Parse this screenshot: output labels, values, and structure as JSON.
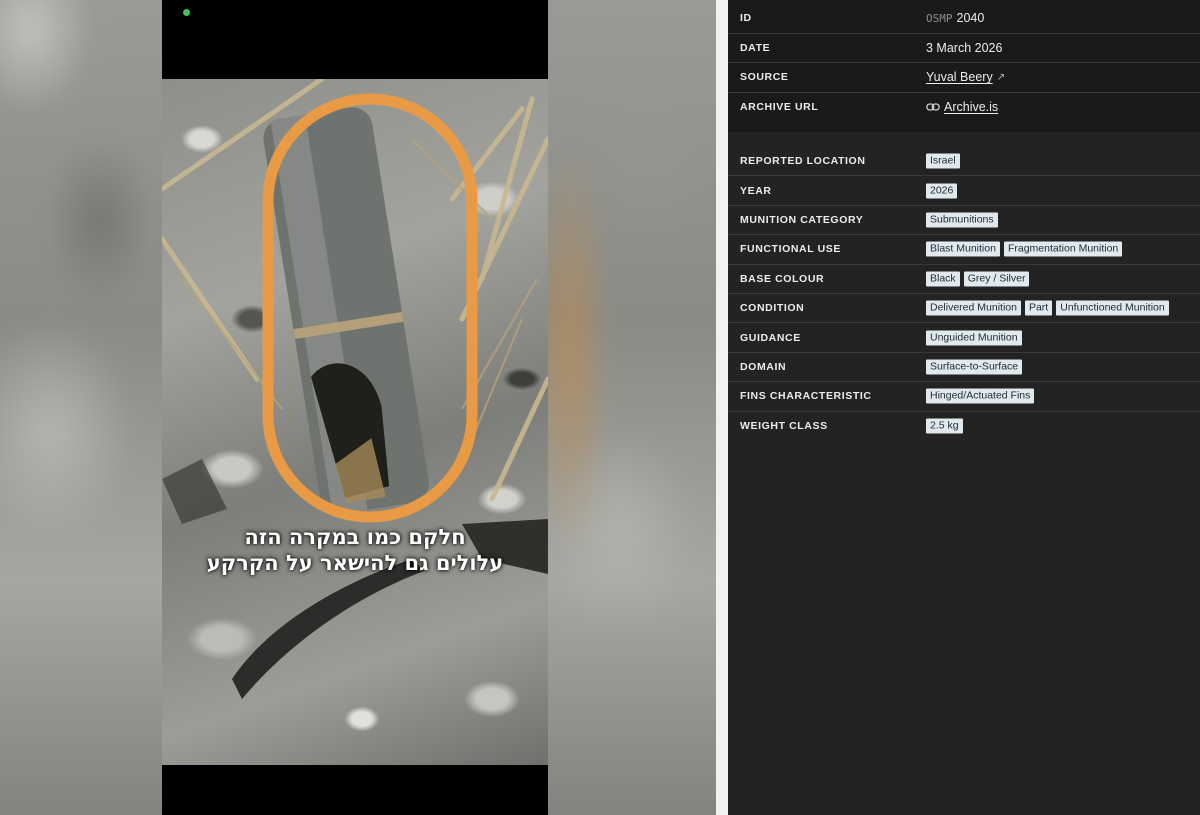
{
  "media": {
    "caption_line1": "חלקם כמו במקרה הזה",
    "caption_line2": "עלולים גם להישאר על הקרקע",
    "highlight_color": "#e89a45",
    "status_dot_color": "#3ec45a"
  },
  "header": {
    "rows": [
      {
        "label": "ID",
        "prefix": "OSMP",
        "value": "2040"
      },
      {
        "label": "DATE",
        "value": "3 March 2026"
      },
      {
        "label": "SOURCE",
        "value": "Yuval Beery",
        "icon": "external-link-icon"
      },
      {
        "label": "ARCHIVE URL",
        "value": "Archive.is",
        "icon": "link-icon"
      }
    ]
  },
  "details": {
    "rows": [
      {
        "label": "REPORTED LOCATION",
        "tags": [
          "Israel"
        ]
      },
      {
        "label": "YEAR",
        "tags": [
          "2026"
        ]
      },
      {
        "label": "MUNITION CATEGORY",
        "tags": [
          "Submunitions"
        ]
      },
      {
        "label": "FUNCTIONAL USE",
        "tags": [
          "Blast Munition",
          "Fragmentation Munition"
        ]
      },
      {
        "label": "BASE COLOUR",
        "tags": [
          "Black",
          "Grey / Silver"
        ]
      },
      {
        "label": "CONDITION",
        "tags": [
          "Delivered Munition",
          "Part",
          "Unfunctioned Munition"
        ]
      },
      {
        "label": "GUIDANCE",
        "tags": [
          "Unguided Munition"
        ]
      },
      {
        "label": "DOMAIN",
        "tags": [
          "Surface-to-Surface"
        ]
      },
      {
        "label": "FINS CHARACTERISTIC",
        "tags": [
          "Hinged/Actuated Fins"
        ]
      },
      {
        "label": "WEIGHT CLASS",
        "tags": [
          "2.5 kg"
        ]
      }
    ]
  },
  "colors": {
    "panel_bg": "#232323",
    "header_bg": "#1a1a1a",
    "tag_bg": "#dfe9ee"
  }
}
